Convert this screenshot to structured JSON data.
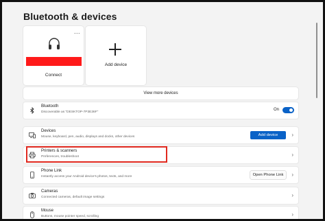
{
  "page": {
    "title": "Bluetooth & devices"
  },
  "device_card": {
    "more": "...",
    "action": "Connect"
  },
  "add_card": {
    "label": "Add device"
  },
  "view_more": "View more devices",
  "bluetooth": {
    "title": "Bluetooth",
    "subtitle": "Discoverable as \"DESKTOP-7P3E36F\"",
    "state_label": "On",
    "on": true
  },
  "rows": [
    {
      "title": "Devices",
      "subtitle": "Mouse, keyboard, pen, audio, displays and docks, other devices",
      "button": "Add device"
    },
    {
      "title": "Printers & scanners",
      "subtitle": "Preferences, troubleshoot"
    },
    {
      "title": "Phone Link",
      "subtitle": "Instantly access your Android device's photos, texts, and more",
      "button": "Open Phone Link"
    },
    {
      "title": "Cameras",
      "subtitle": "Connected cameras, default image settings"
    },
    {
      "title": "Mouse",
      "subtitle": "Buttons, mouse pointer speed, scrolling"
    }
  ],
  "colors": {
    "accent": "#0a62c7",
    "redacted": "#ff1a1a",
    "highlight": "#e0281e"
  },
  "icons": {
    "device": "headphones-icon",
    "add": "plus-icon",
    "bluetooth": "bluetooth-icon",
    "devices": "devices-icon",
    "printers": "printer-icon",
    "phone": "phone-icon",
    "camera": "camera-icon",
    "mouse": "mouse-icon",
    "chevron": "chevron-right-icon"
  }
}
